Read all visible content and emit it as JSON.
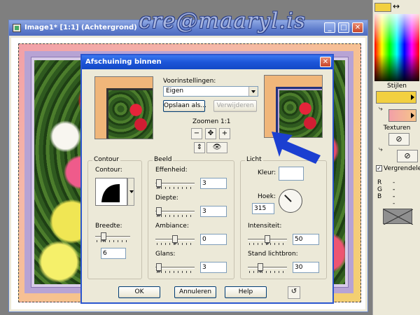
{
  "watermark": "cre@maaryl.is",
  "image_window": {
    "title": "Image1* [1:1] (Achtergrond)",
    "buttons": {
      "minimize": "_",
      "maximize": "□",
      "close": "✕"
    }
  },
  "dialog": {
    "title": "Afschuining binnen",
    "close_glyph": "✕",
    "presets_label": "Voorinstellingen:",
    "preset_value": "Eigen",
    "save_as": "Opslaan als...",
    "delete": "Verwijderen",
    "zoom_label": "Zoomen 1:1",
    "zoom_icons": [
      "zoom-out-icon",
      "pan-icon",
      "zoom-in-icon"
    ],
    "contour": {
      "group_title": "Contour",
      "label": "Contour:",
      "width_label": "Breedte:",
      "width_value": "6",
      "width_level": 0.2
    },
    "image": {
      "group_title": "Beeld",
      "sliders": [
        {
          "label": "Effenheid:",
          "value": "3",
          "level": 0.03
        },
        {
          "label": "Diepte:",
          "value": "3",
          "level": 0.03
        },
        {
          "label": "Ambiance:",
          "value": "0",
          "level": 0.5
        },
        {
          "label": "Glans:",
          "value": "3",
          "level": 0.03
        }
      ]
    },
    "light": {
      "group_title": "Licht",
      "color_label": "Kleur:",
      "color": "#ffffff",
      "angle_label": "Hoek:",
      "angle_value": "315",
      "intensity_label": "Intensiteit:",
      "intensity_value": "50",
      "intensity_level": 0.5,
      "position_label": "Stand lichtbron:",
      "position_value": "30",
      "position_level": 0.3
    },
    "buttons": {
      "ok": "OK",
      "cancel": "Annuleren",
      "help": "Help"
    }
  },
  "palette": {
    "swap_glyph": "↔",
    "styles_label": "Stijlen",
    "textures_label": "Texturen",
    "lock_label": "Vergrendelen",
    "rgb": [
      {
        "name": "R",
        "value": "--"
      },
      {
        "name": "G",
        "value": "--"
      },
      {
        "name": "B",
        "value": "--"
      }
    ],
    "colors": {
      "foreground": "#f2d040",
      "background_gradient_start": "#f2a0a8"
    }
  },
  "colors": {
    "dialog_title_blue": "#1c55d8",
    "arrow_blue": "#1b3fd1",
    "frame_peach": "#f0b67a",
    "frame_lilac": "#b7a3d4"
  }
}
